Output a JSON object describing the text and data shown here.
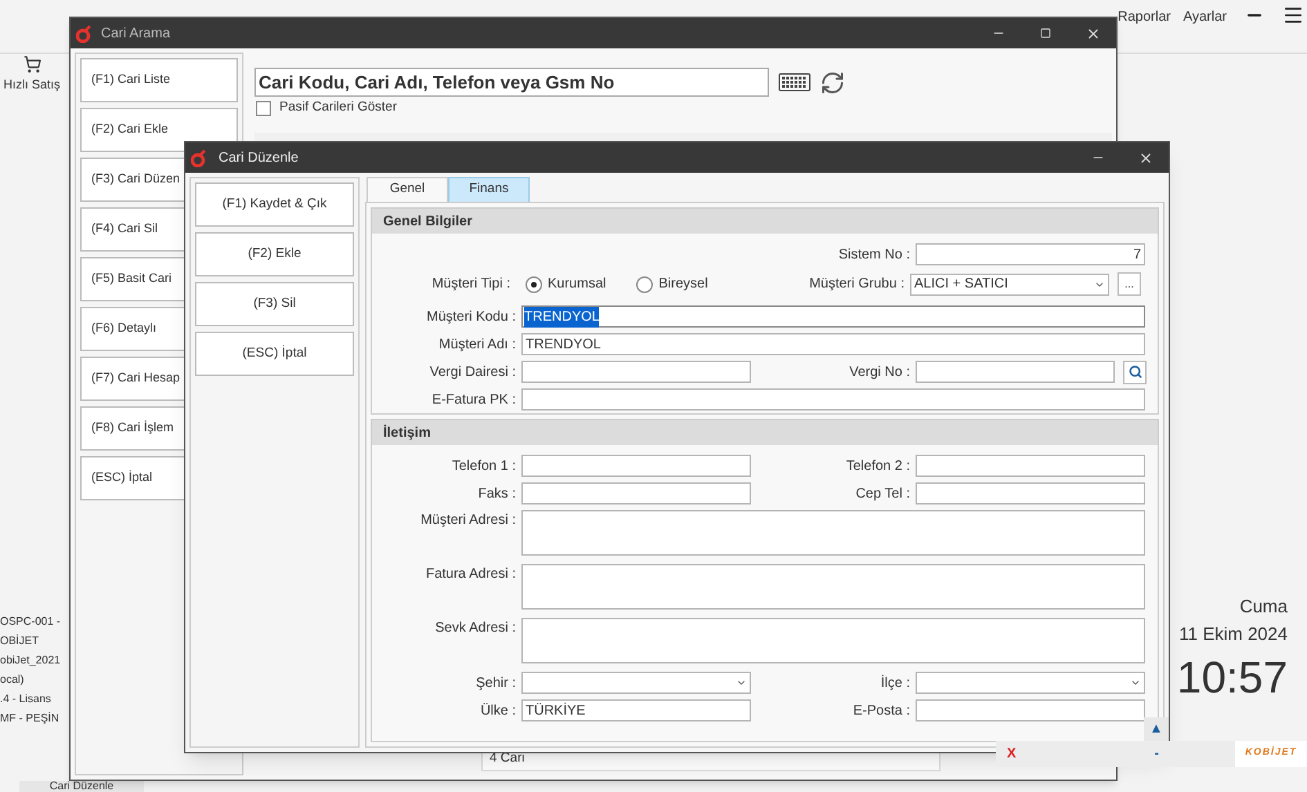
{
  "top_menu": [
    {
      "label": "Raporlar"
    },
    {
      "label": "Ayarlar"
    }
  ],
  "side_shortcut": {
    "label": "Hızlı Satış"
  },
  "session_info": [
    "OSPC-001 -",
    "OBİJET",
    "obiJet_2021",
    "ocal)",
    ".4 - Lisans",
    "MF - PEŞİN"
  ],
  "clock": {
    "day": "Cuma",
    "date": "11 Ekim 2024",
    "time": "10:57"
  },
  "bottom_tab": {
    "label": "Cari Düzenle"
  },
  "notification": {
    "up": "▲",
    "close": "X",
    "minimize": "-",
    "logo": "KOBİJET"
  },
  "search_window": {
    "title": "Cari Arama",
    "buttons": [
      "(F1) Cari Liste",
      "(F2) Cari Ekle",
      "(F3) Cari Düzen",
      "(F4) Cari Sil",
      "(F5) Basit Cari",
      "(F6) Detaylı",
      "(F7) Cari Hesap",
      "(F8) Cari İşlem",
      "(ESC) İptal"
    ],
    "search": {
      "placeholder": "Cari Kodu, Cari Adı, Telefon veya Gsm No"
    },
    "passive_filter": {
      "label": "Pasif Carileri Göster",
      "checked": false
    },
    "footer": "4 Cari"
  },
  "edit_dialog": {
    "title": "Cari Düzenle",
    "buttons": [
      "(F1) Kaydet & Çık",
      "(F2) Ekle",
      "(F3) Sil",
      "(ESC) İptal"
    ],
    "tabs": [
      {
        "label": "Genel",
        "selected": true
      },
      {
        "label": "Finans",
        "selected": false
      }
    ],
    "general": {
      "title": "Genel Bilgiler",
      "system_no": {
        "label": "Sistem No :",
        "value": "7"
      },
      "customer_type": {
        "label": "Müşteri Tipi :",
        "options": [
          {
            "label": "Kurumsal",
            "selected": true
          },
          {
            "label": "Bireysel",
            "selected": false
          }
        ]
      },
      "customer_group": {
        "label": "Müşteri Grubu :",
        "value": "ALICI + SATICI",
        "more": "..."
      },
      "customer_code": {
        "label": "Müşteri Kodu :",
        "value": "TRENDYOL",
        "text_selected": true
      },
      "customer_name": {
        "label": "Müşteri Adı :",
        "value": "TRENDYOL"
      },
      "tax_office": {
        "label": "Vergi Dairesi :"
      },
      "tax_no": {
        "label": "Vergi No :"
      },
      "einvoice": {
        "label": "E-Fatura PK :"
      }
    },
    "contact": {
      "title": "İletişim",
      "phone1": {
        "label": "Telefon 1 :"
      },
      "phone2": {
        "label": "Telefon 2 :"
      },
      "fax": {
        "label": "Faks :"
      },
      "mobile": {
        "label": "Cep Tel :"
      },
      "address": {
        "label": "Müşteri Adresi :"
      },
      "invoice_address": {
        "label": "Fatura Adresi :"
      },
      "shipping_address": {
        "label": "Sevk Adresi :"
      },
      "city": {
        "label": "Şehir :"
      },
      "district": {
        "label": "İlçe :"
      },
      "country": {
        "label": "Ülke :",
        "value": "TÜRKİYE"
      },
      "email": {
        "label": "E-Posta :"
      }
    }
  }
}
